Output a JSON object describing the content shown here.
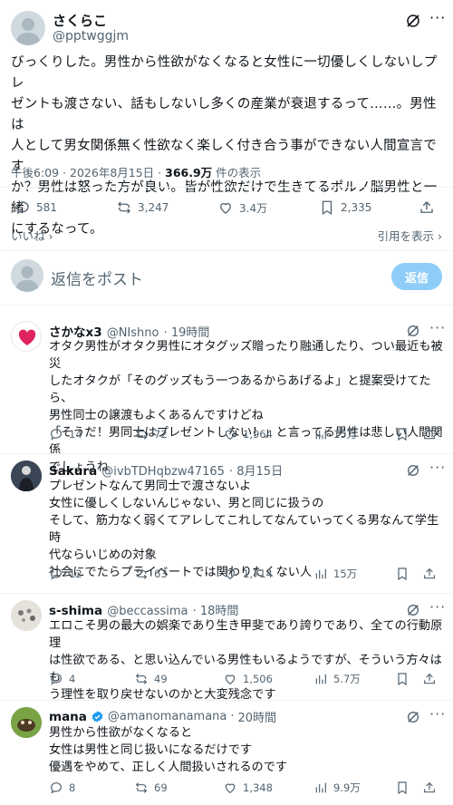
{
  "main_post": {
    "display_name": "さくらこ",
    "handle": "@pptwggjm",
    "text_lines": [
      "びっくりした。男性から性欲がなくなると女性に一切優しくしないしプレ",
      "ゼントも渡さない、話もしないし多くの産業が衰退するって……。男性は",
      "人として男女関係無く性欲なく楽しく付き合う事ができない人間宣言です",
      "か？男性は怒った方が良い。皆が性欲だけで生きてるポルノ脳男性と一緒",
      "にするなって。"
    ],
    "time": "午後6:09",
    "date": "2026年8月15日",
    "views": "366.9万",
    "views_suffix": "件の表示",
    "replies": "581",
    "reposts": "3,247",
    "likes": "3.4万",
    "bookmarks": "2,335",
    "liked_by_label": "いいね",
    "quotes_label": "引用を表示"
  },
  "reply_box": {
    "placeholder": "返信をポスト",
    "button": "返信"
  },
  "replies": [
    {
      "name": "さかなx3",
      "handle": "@NIshno",
      "time": "19時間",
      "lines": [
        "オタク男性がオタク男性にオタグッズ贈ったり融通したり、つい最近も被災",
        "したオタクが「そのグッズもう一つあるからあげるよ」と提案受けてたら、",
        "男性同士の譲渡もよくあるんですけどね",
        "「そうだ！男同士はプレゼントしない！」と言ってる男性は悲しい人間関係",
        "でしょうね"
      ],
      "replies": "14",
      "reposts": "72",
      "likes": "1,964",
      "views": "15万"
    },
    {
      "name": "Sakura",
      "handle": "@ivbTDHqbzw47165",
      "time": "8月15日",
      "lines": [
        "プレゼントなんて男同士で渡さないよ",
        "女性に優しくしないんじゃない、男と同じに扱うの",
        "そして、筋力なく弱くてアレしてこれしてなんていってくる男なんて学生時",
        "代ならいじめの対象",
        "社会にでたらプライベートでは関わりたくない人"
      ],
      "replies": "12",
      "reposts": "63",
      "likes": "1,714",
      "views": "15万"
    },
    {
      "name": "s-shima",
      "handle": "@beccassima",
      "time": "18時間",
      "lines": [
        "エロこそ男の最大の娯楽であり生き甲斐であり誇りであり、全ての行動原理",
        "は性欲である、と思い込んでいる男性もいるようですが、そういう方々はも",
        "う理性を取り戻せないのかと大変残念です"
      ],
      "replies": "4",
      "reposts": "49",
      "likes": "1,506",
      "views": "5.7万"
    },
    {
      "name": "mana",
      "handle": "@amanomanamana",
      "time": "20時間",
      "lines": [
        "男性から性欲がなくなると",
        "女性は男性と同じ扱いになるだけです",
        "優遇をやめて、正しく人間扱いされるのです"
      ],
      "replies": "8",
      "reposts": "69",
      "likes": "1,348",
      "views": "9.9万"
    }
  ],
  "colors": {
    "verified": "#1d9bf0",
    "muted": "#536471",
    "reply_button_bg": "#8ecdf8"
  }
}
